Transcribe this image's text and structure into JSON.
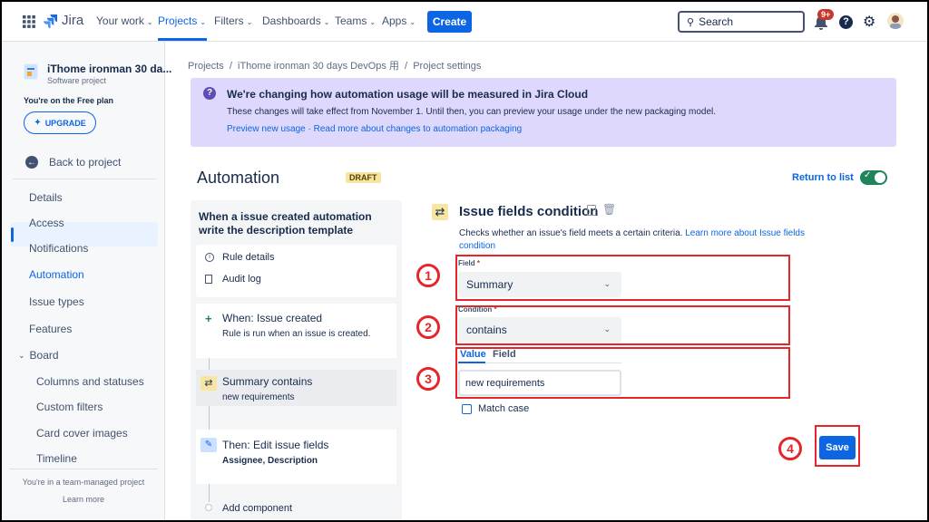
{
  "nav": {
    "app_name": "Jira",
    "items": [
      "Your work",
      "Projects",
      "Filters",
      "Dashboards",
      "Teams",
      "Apps"
    ],
    "create": "Create",
    "search": "Search",
    "notif_count": "9+"
  },
  "sidebar": {
    "project_name": "iThome ironman 30 da...",
    "project_type": "Software project",
    "plan": "You're on the Free plan",
    "upgrade": "UPGRADE",
    "back": "Back to project",
    "items": [
      "Details",
      "Access",
      "Notifications",
      "Automation",
      "Issue types",
      "Features"
    ],
    "board": "Board",
    "board_items": [
      "Columns and statuses",
      "Custom filters",
      "Card cover images",
      "Timeline"
    ],
    "footer": "You're in a team-managed project",
    "learn_more": "Learn more"
  },
  "breadcrumb": "Projects  /  iThome ironman 30 days DevOps 用  /  Project settings",
  "banner": {
    "title": "We're changing how automation usage will be measured in Jira Cloud",
    "text": "These changes will take effect from November 1. Until then, you can preview your usage under the new packaging model.",
    "link1": "Preview new usage",
    "sep": " · ",
    "link2": "Read more about changes to automation packaging"
  },
  "automation": {
    "title": "Automation",
    "status": "DRAFT",
    "return": "Return to list"
  },
  "rule": {
    "name": "When a issue created automation write the description template",
    "details": "Rule details",
    "audit": "Audit log",
    "trigger_title": "When: Issue created",
    "trigger_desc": "Rule is run when an issue is created.",
    "cond_title": "Summary contains",
    "cond_desc": "new requirements",
    "action_title": "Then: Edit issue fields",
    "action_desc": "Assignee, Description",
    "add": "Add component"
  },
  "condition": {
    "title": "Issue fields condition",
    "desc": "Checks whether an issue's field meets a certain criteria.",
    "learn": "Learn more about Issue fields",
    "learn2": "condition",
    "field_label": "Field",
    "field_value": "Summary",
    "condition_label": "Condition",
    "condition_value": "contains",
    "tab_value": "Value",
    "tab_field": "Field",
    "value": "new requirements",
    "match_case": "Match case",
    "save": "Save"
  },
  "annotations": [
    "1",
    "2",
    "3",
    "4"
  ],
  "colors": {
    "brand": "#0c66e4",
    "annotation": "#e5252a",
    "toggle": "#1f845a",
    "banner": "#dfd8fd"
  }
}
